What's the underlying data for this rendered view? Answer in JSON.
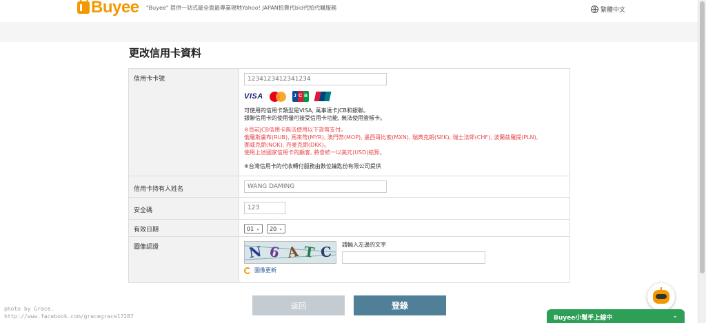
{
  "header": {
    "logo_text": "Buyee",
    "tagline": "\"Buyee\" 提供一站式最全面最專業現地Yahoo! JAPAN拍賣代bid代拍代購服務",
    "language": "繁體中文"
  },
  "page": {
    "title": "更改信用卡資料"
  },
  "form": {
    "card_number": {
      "label": "信用卡卡號",
      "placeholder": "1234123412341234",
      "brands": [
        "VISA",
        "Mastercard",
        "JCB",
        "UnionPay"
      ],
      "brand_texts": {
        "visa": "VISA",
        "jcb": [
          "J",
          "C",
          "B"
        ]
      },
      "note_lines": [
        "可使用的信用卡類型是VISA, 萬事達卡JCB和銀聯。",
        "銀聯信用卡的使用僅可接受信用卡功能, 無法使用簽帳卡。"
      ],
      "warning_lines": [
        "※目前JCB信用卡無法使用以下貨幣支付。",
        "俄羅斯盧布(RUB), 馬來幣(MYR), 澳門幣(MOP), 墨西哥比索(MXN), 瑞典克朗(SEK), 瑞士法郎(CHF), 波蘭茲羅提(PLN),",
        "挪威克朗(NOK), 丹麥克朗(DKK)。",
        "使用上述國家信用卡的顧客, 將會統一以美元(USD)結算。"
      ],
      "provider_note": "※台灣信用卡的代收轉付服務由數位鑰匙份有限公司提供"
    },
    "cardholder": {
      "label": "信用卡持有人姓名",
      "placeholder": "WANG DAMING"
    },
    "security_code": {
      "label": "安全碼",
      "placeholder": "123"
    },
    "expiry": {
      "label": "有效日期",
      "month": "01",
      "year": "20"
    },
    "captcha": {
      "label": "圖像認證",
      "chars": [
        "N",
        "6",
        "A",
        "T",
        "C"
      ],
      "input_label": "請輸入左邊的文字",
      "refresh_label": "圖像更新"
    }
  },
  "buttons": {
    "back": "返回",
    "submit": "登錄"
  },
  "watermark": {
    "line1": "photo by Grace.",
    "line2": "http://www.facebook.com/gracegrace17287"
  },
  "chat": {
    "label": "Buyee小幫手上線中",
    "chevron": "⌄"
  },
  "colors": {
    "brand": "#f39800",
    "submit": "#4f8098",
    "back": "#c5ccd1",
    "warning": "#e8474c",
    "chat": "#2d9f57"
  }
}
